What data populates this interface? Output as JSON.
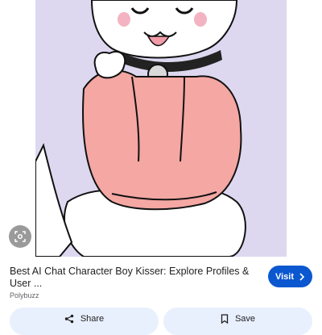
{
  "result": {
    "title": "Best AI Chat Character Boy Kisser: Explore Profiles & User ...",
    "source": "Polybuzz",
    "image_alt_icon": "cartoon-character-image"
  },
  "actions": {
    "visit_label": "Visit",
    "share_label": "Share",
    "save_label": "Save"
  },
  "icons": {
    "lens": "lens-icon",
    "visit": "chevron-right-icon",
    "share": "share-icon",
    "save": "bookmark-icon"
  },
  "colors": {
    "accent": "#0b57d0",
    "button_bg": "#e8f0fe",
    "image_bg": "#ddd8f0",
    "hoodie": "#f4a7a3"
  }
}
